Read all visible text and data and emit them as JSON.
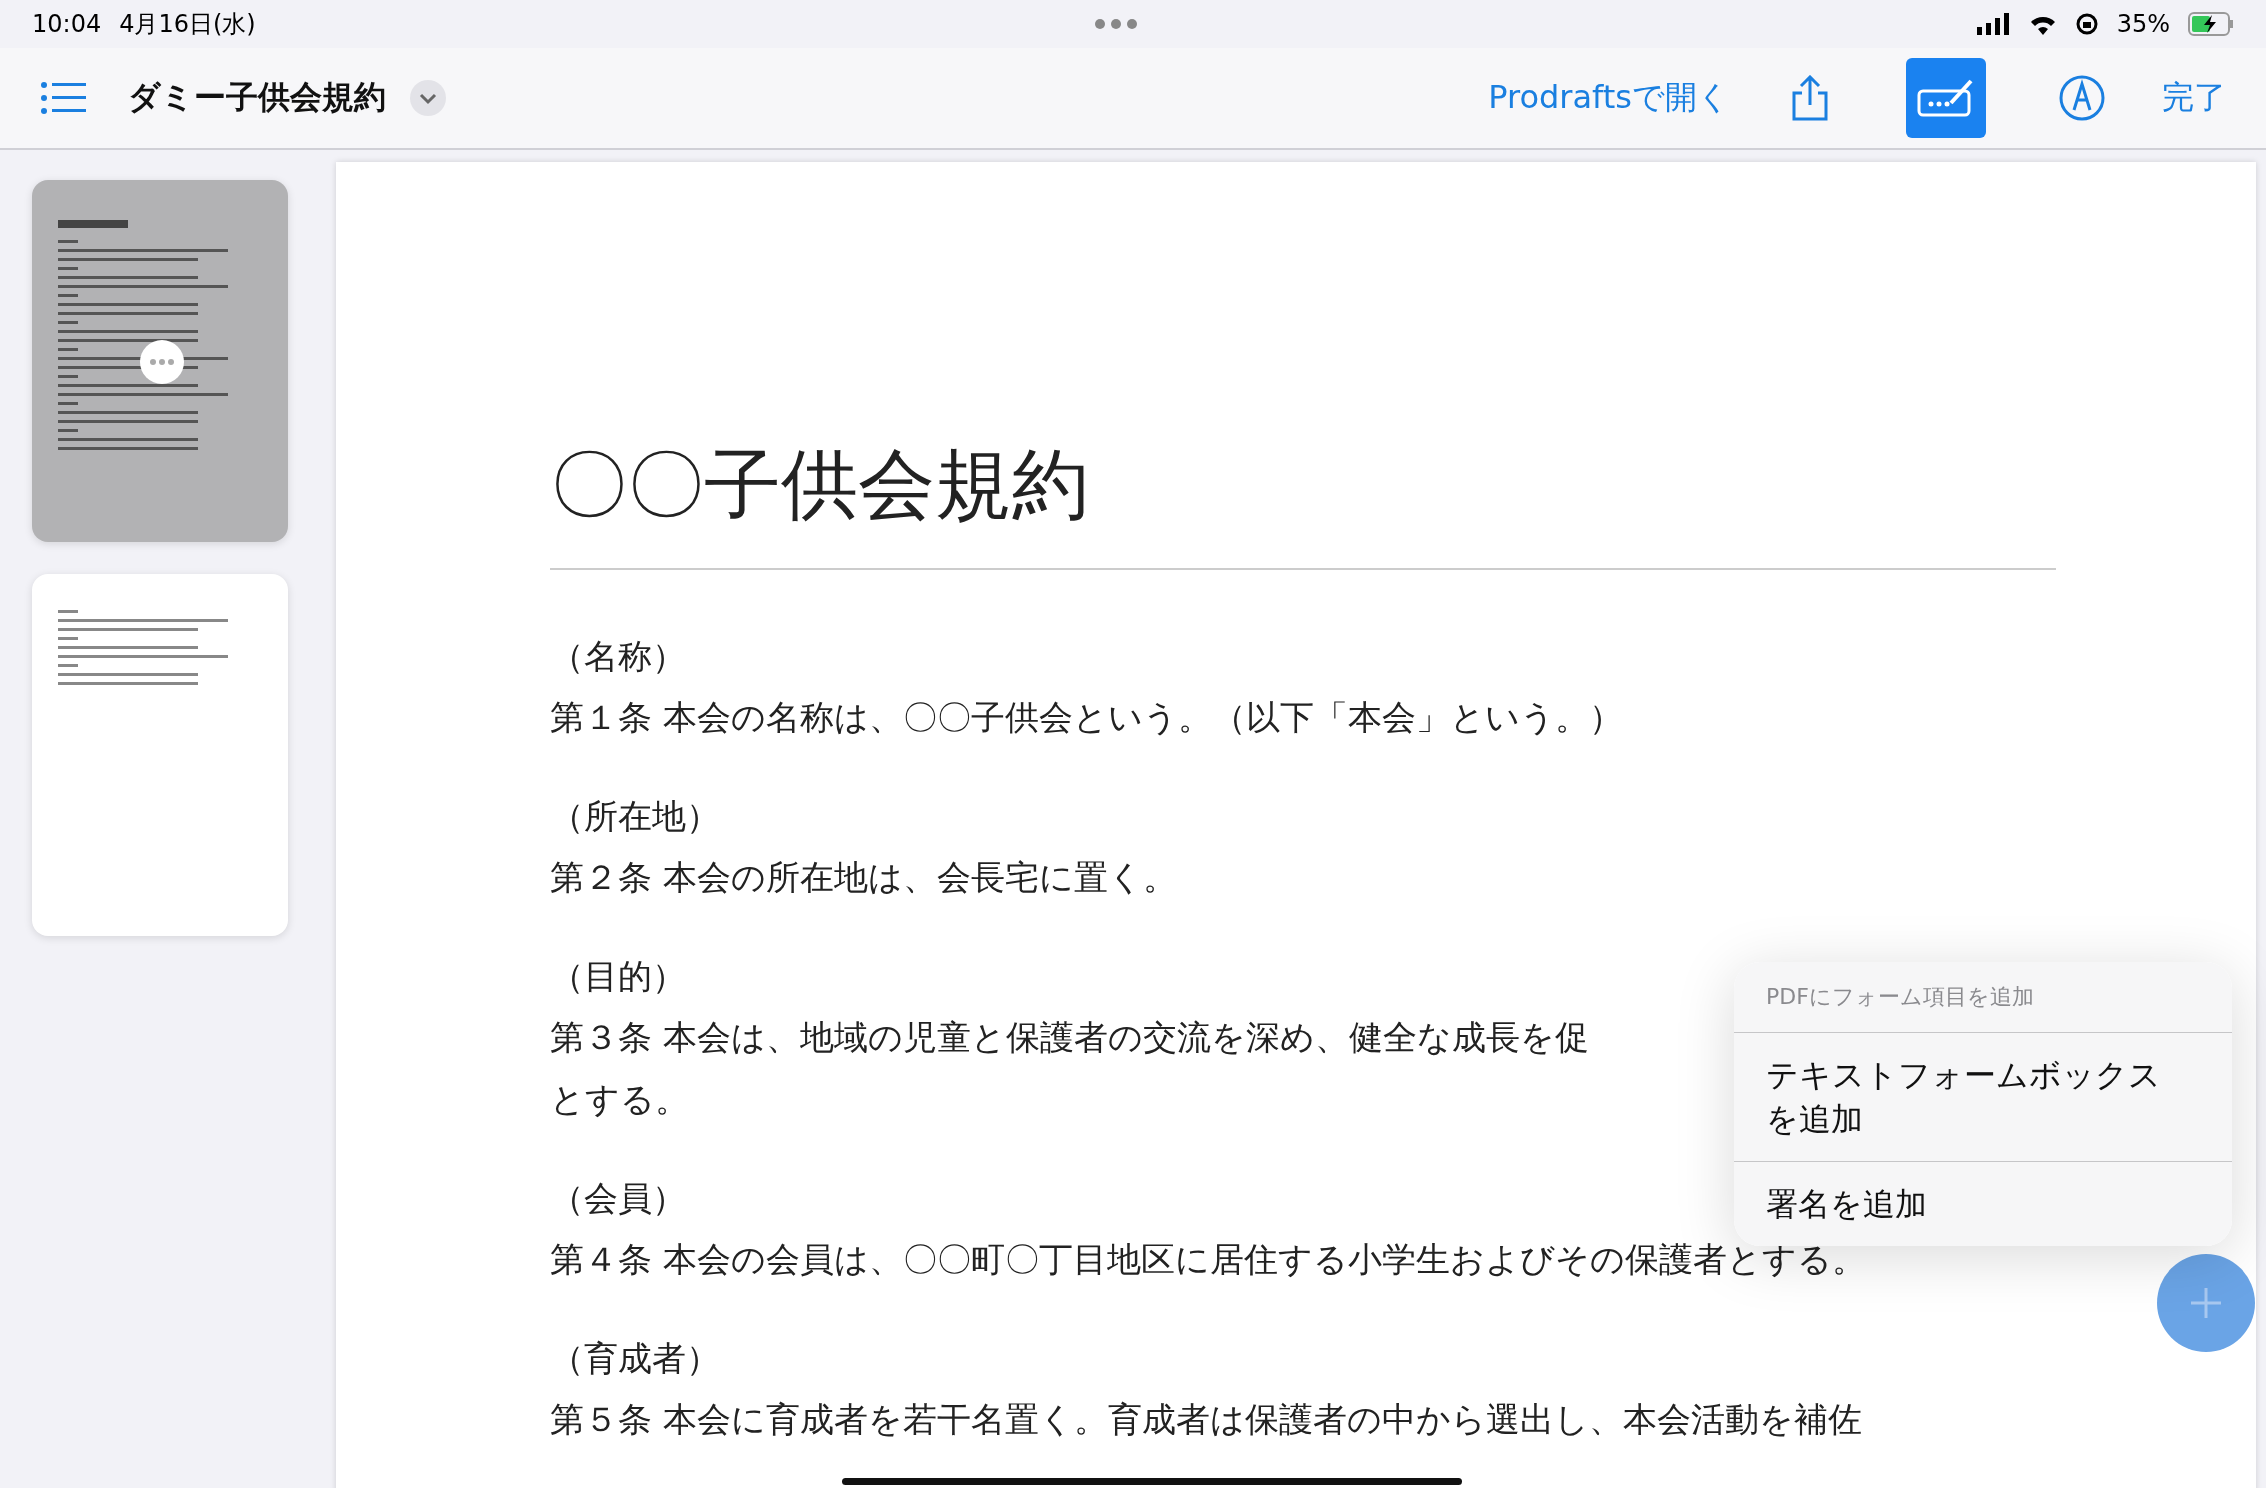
{
  "status_bar": {
    "time": "10:04",
    "date": "4月16日(水)",
    "battery": "35%"
  },
  "toolbar": {
    "title": "ダミー子供会規約",
    "open_in": "Prodraftsで開く",
    "done": "完了",
    "buttons": [
      {
        "kind": "share",
        "selected": false
      },
      {
        "kind": "form",
        "selected": true
      },
      {
        "kind": "markup",
        "selected": false
      }
    ]
  },
  "thumbnails": [
    {
      "selected": true
    },
    {
      "selected": false
    }
  ],
  "document": {
    "title": "〇〇子供会規約",
    "sections": [
      {
        "heading": "（名称）",
        "lines": [
          "第１条 本会の名称は、〇〇子供会という。（以下「本会」という。）"
        ]
      },
      {
        "heading": "（所在地）",
        "lines": [
          "第２条 本会の所在地は、会長宅に置く。"
        ]
      },
      {
        "heading": "（目的）",
        "lines": [
          "第３条 本会は、地域の児童と保護者の交流を深め、健全な成長を促",
          "とする。"
        ]
      },
      {
        "heading": "（会員）",
        "lines": [
          "第４条 本会の会員は、〇〇町〇丁目地区に居住する小学生およびその保護者とする。"
        ]
      },
      {
        "heading": "（育成者）",
        "lines": [
          "第５条 本会に育成者を若干名置く。育成者は保護者の中から選出し、本会活動を補佐"
        ]
      }
    ]
  },
  "menu": {
    "header": "PDFにフォーム項目を追加",
    "items": [
      "テキストフォームボックスを追加",
      "署名を追加"
    ]
  }
}
